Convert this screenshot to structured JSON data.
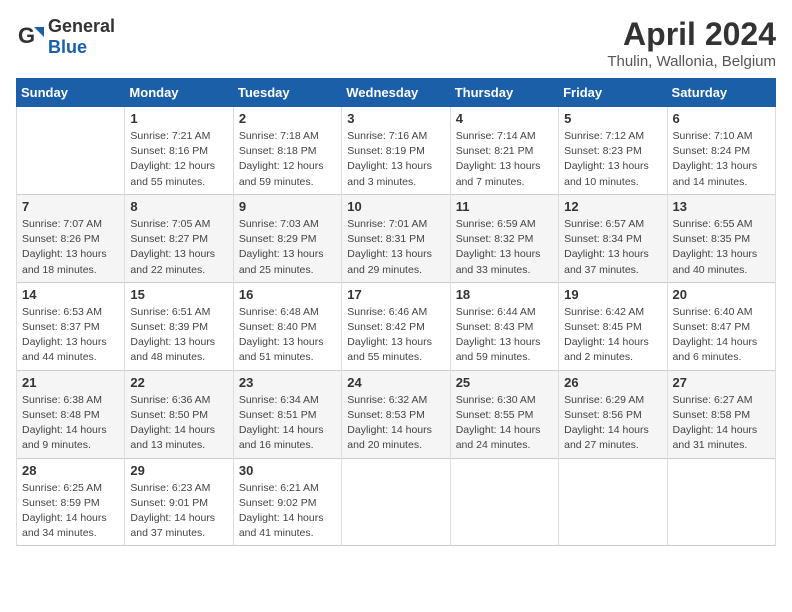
{
  "logo": {
    "general": "General",
    "blue": "Blue"
  },
  "title": "April 2024",
  "subtitle": "Thulin, Wallonia, Belgium",
  "days_of_week": [
    "Sunday",
    "Monday",
    "Tuesday",
    "Wednesday",
    "Thursday",
    "Friday",
    "Saturday"
  ],
  "weeks": [
    [
      {
        "day": "",
        "info": ""
      },
      {
        "day": "1",
        "info": "Sunrise: 7:21 AM\nSunset: 8:16 PM\nDaylight: 12 hours\nand 55 minutes."
      },
      {
        "day": "2",
        "info": "Sunrise: 7:18 AM\nSunset: 8:18 PM\nDaylight: 12 hours\nand 59 minutes."
      },
      {
        "day": "3",
        "info": "Sunrise: 7:16 AM\nSunset: 8:19 PM\nDaylight: 13 hours\nand 3 minutes."
      },
      {
        "day": "4",
        "info": "Sunrise: 7:14 AM\nSunset: 8:21 PM\nDaylight: 13 hours\nand 7 minutes."
      },
      {
        "day": "5",
        "info": "Sunrise: 7:12 AM\nSunset: 8:23 PM\nDaylight: 13 hours\nand 10 minutes."
      },
      {
        "day": "6",
        "info": "Sunrise: 7:10 AM\nSunset: 8:24 PM\nDaylight: 13 hours\nand 14 minutes."
      }
    ],
    [
      {
        "day": "7",
        "info": "Sunrise: 7:07 AM\nSunset: 8:26 PM\nDaylight: 13 hours\nand 18 minutes."
      },
      {
        "day": "8",
        "info": "Sunrise: 7:05 AM\nSunset: 8:27 PM\nDaylight: 13 hours\nand 22 minutes."
      },
      {
        "day": "9",
        "info": "Sunrise: 7:03 AM\nSunset: 8:29 PM\nDaylight: 13 hours\nand 25 minutes."
      },
      {
        "day": "10",
        "info": "Sunrise: 7:01 AM\nSunset: 8:31 PM\nDaylight: 13 hours\nand 29 minutes."
      },
      {
        "day": "11",
        "info": "Sunrise: 6:59 AM\nSunset: 8:32 PM\nDaylight: 13 hours\nand 33 minutes."
      },
      {
        "day": "12",
        "info": "Sunrise: 6:57 AM\nSunset: 8:34 PM\nDaylight: 13 hours\nand 37 minutes."
      },
      {
        "day": "13",
        "info": "Sunrise: 6:55 AM\nSunset: 8:35 PM\nDaylight: 13 hours\nand 40 minutes."
      }
    ],
    [
      {
        "day": "14",
        "info": "Sunrise: 6:53 AM\nSunset: 8:37 PM\nDaylight: 13 hours\nand 44 minutes."
      },
      {
        "day": "15",
        "info": "Sunrise: 6:51 AM\nSunset: 8:39 PM\nDaylight: 13 hours\nand 48 minutes."
      },
      {
        "day": "16",
        "info": "Sunrise: 6:48 AM\nSunset: 8:40 PM\nDaylight: 13 hours\nand 51 minutes."
      },
      {
        "day": "17",
        "info": "Sunrise: 6:46 AM\nSunset: 8:42 PM\nDaylight: 13 hours\nand 55 minutes."
      },
      {
        "day": "18",
        "info": "Sunrise: 6:44 AM\nSunset: 8:43 PM\nDaylight: 13 hours\nand 59 minutes."
      },
      {
        "day": "19",
        "info": "Sunrise: 6:42 AM\nSunset: 8:45 PM\nDaylight: 14 hours\nand 2 minutes."
      },
      {
        "day": "20",
        "info": "Sunrise: 6:40 AM\nSunset: 8:47 PM\nDaylight: 14 hours\nand 6 minutes."
      }
    ],
    [
      {
        "day": "21",
        "info": "Sunrise: 6:38 AM\nSunset: 8:48 PM\nDaylight: 14 hours\nand 9 minutes."
      },
      {
        "day": "22",
        "info": "Sunrise: 6:36 AM\nSunset: 8:50 PM\nDaylight: 14 hours\nand 13 minutes."
      },
      {
        "day": "23",
        "info": "Sunrise: 6:34 AM\nSunset: 8:51 PM\nDaylight: 14 hours\nand 16 minutes."
      },
      {
        "day": "24",
        "info": "Sunrise: 6:32 AM\nSunset: 8:53 PM\nDaylight: 14 hours\nand 20 minutes."
      },
      {
        "day": "25",
        "info": "Sunrise: 6:30 AM\nSunset: 8:55 PM\nDaylight: 14 hours\nand 24 minutes."
      },
      {
        "day": "26",
        "info": "Sunrise: 6:29 AM\nSunset: 8:56 PM\nDaylight: 14 hours\nand 27 minutes."
      },
      {
        "day": "27",
        "info": "Sunrise: 6:27 AM\nSunset: 8:58 PM\nDaylight: 14 hours\nand 31 minutes."
      }
    ],
    [
      {
        "day": "28",
        "info": "Sunrise: 6:25 AM\nSunset: 8:59 PM\nDaylight: 14 hours\nand 34 minutes."
      },
      {
        "day": "29",
        "info": "Sunrise: 6:23 AM\nSunset: 9:01 PM\nDaylight: 14 hours\nand 37 minutes."
      },
      {
        "day": "30",
        "info": "Sunrise: 6:21 AM\nSunset: 9:02 PM\nDaylight: 14 hours\nand 41 minutes."
      },
      {
        "day": "",
        "info": ""
      },
      {
        "day": "",
        "info": ""
      },
      {
        "day": "",
        "info": ""
      },
      {
        "day": "",
        "info": ""
      }
    ]
  ]
}
